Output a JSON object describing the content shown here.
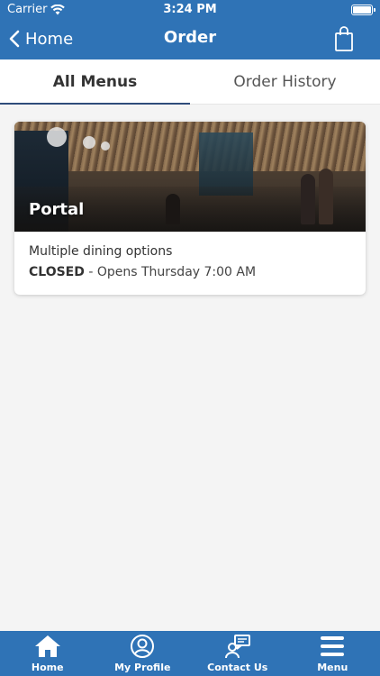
{
  "status_bar": {
    "carrier": "Carrier",
    "time": "3:24 PM"
  },
  "nav": {
    "back_label": "Home",
    "title": "Order"
  },
  "tabs": [
    {
      "label": "All Menus",
      "active": true
    },
    {
      "label": "Order History",
      "active": false
    }
  ],
  "cards": [
    {
      "title": "Portal",
      "description": "Multiple dining options",
      "status": "CLOSED",
      "status_detail": " - Opens Thursday 7:00 AM"
    }
  ],
  "bottom_nav": [
    {
      "label": "Home",
      "icon": "home-icon"
    },
    {
      "label": "My Profile",
      "icon": "profile-icon"
    },
    {
      "label": "Contact Us",
      "icon": "contact-icon"
    },
    {
      "label": "Menu",
      "icon": "menu-icon"
    }
  ],
  "colors": {
    "primary": "#2f73b6",
    "tab_indicator": "#2f4c7a",
    "background": "#f4f4f4"
  }
}
